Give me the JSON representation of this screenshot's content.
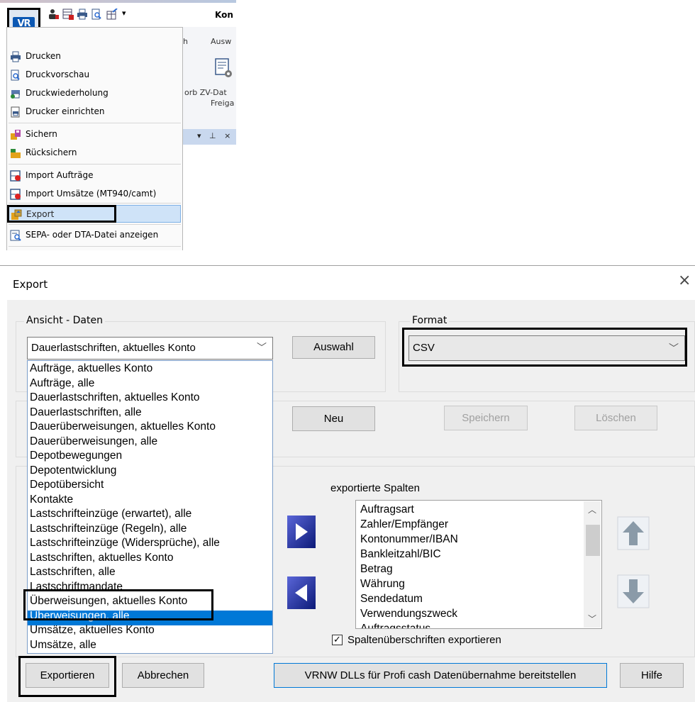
{
  "window": {
    "title_partial": "Kon"
  },
  "ribbon": {
    "tab_left_partial": "h",
    "tab_partial": "Ausw",
    "label1_partial": "orb ZV-Dat",
    "label2_partial": "Freiga",
    "panel_controls": "▾ ⊥ ×"
  },
  "app_menu": {
    "items": [
      {
        "label": "Drucken",
        "icon": "printer-icon"
      },
      {
        "label": "Druckvorschau",
        "icon": "print-preview-icon"
      },
      {
        "label": "Druckwiederholung",
        "icon": "print-repeat-icon"
      },
      {
        "label": "Drucker einrichten",
        "icon": "printer-setup-icon"
      },
      {
        "label": "Sichern",
        "icon": "backup-icon"
      },
      {
        "label": "Rücksichern",
        "icon": "restore-icon"
      },
      {
        "label": "Import Aufträge",
        "icon": "import-orders-icon"
      },
      {
        "label": "Import Umsätze (MT940/camt)",
        "icon": "import-transactions-icon"
      },
      {
        "label": "Export",
        "icon": "export-icon",
        "selected": true
      },
      {
        "label": "SEPA- oder DTA-Datei anzeigen",
        "icon": "sepa-file-icon"
      }
    ]
  },
  "dialog": {
    "title": "Export",
    "close": "×",
    "view_group_label": "Ansicht - Daten",
    "view_selected": "Dauerlastschriften, aktuelles Konto",
    "view_options": [
      "Aufträge, aktuelles Konto",
      "Aufträge, alle",
      "Dauerlastschriften, aktuelles Konto",
      "Dauerlastschriften, alle",
      "Dauerüberweisungen, aktuelles Konto",
      "Dauerüberweisungen, alle",
      "Depotbewegungen",
      "Depotentwicklung",
      "Depotübersicht",
      "Kontakte",
      "Lastschrifteinzüge (erwartet), alle",
      "Lastschrifteinzüge (Regeln), alle",
      "Lastschrifteinzüge (Widersprüche), alle",
      "Lastschriften, aktuelles Konto",
      "Lastschriften, alle",
      "Lastschriftmandate",
      "Überweisungen, aktuelles Konto",
      "Überweisungen, alle",
      "Umsätze, aktuelles Konto",
      "Umsätze, alle"
    ],
    "highlighted_option_index": 17,
    "format_group_label": "Format",
    "format_value": "CSV",
    "buttons": {
      "auswahl": "Auswahl",
      "neu": "Neu",
      "speichern": "Speichern",
      "loeschen": "Löschen",
      "exportieren": "Exportieren",
      "abbrechen": "Abbrechen",
      "vrnw": "VRNW DLLs für Profi cash Datenübernahme bereitstellen",
      "hilfe": "Hilfe"
    },
    "exported_columns_label": "exportierte Spalten",
    "exported_columns": [
      "Auftragsart",
      "Zahler/Empfänger",
      "Kontonummer/IBAN",
      "Bankleitzahl/BIC",
      "Betrag",
      "Währung",
      "Sendedatum",
      "Verwendungszweck",
      "Auftragsstatus"
    ],
    "export_headers_checkbox": {
      "label": "Spaltenüberschriften exportieren",
      "checked": true
    }
  }
}
